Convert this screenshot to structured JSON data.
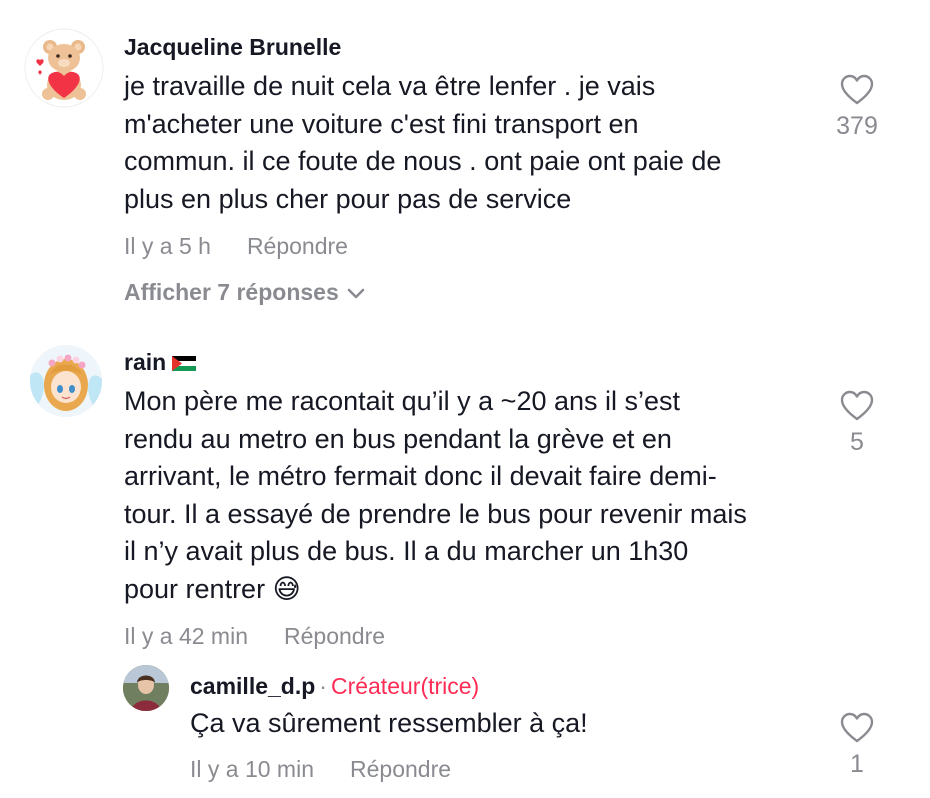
{
  "comments": [
    {
      "username": "Jacqueline Brunelle",
      "text": "je travaille de nuit cela va être lenfer . je vais\nm'acheter une voiture c'est fini transport en\ncommun. il ce foute de nous . ont paie ont paie de\nplus en plus cher pour pas de service",
      "time": "Il y a 5 h",
      "reply_label": "Répondre",
      "likes": "379",
      "view_replies": "Afficher 7 réponses",
      "avatar_icon": "teddy-bear-heart-icon"
    },
    {
      "username": "rain",
      "flag_icon": "palestine-flag-icon",
      "text": "Mon père me racontait qu’il y a ~20 ans il s’est\nrendu au metro en bus pendant la grève et en\narrivant, le métro fermait donc il devait faire demi-\ntour. Il a essayé de prendre le bus pour revenir mais\nil n’y avait plus de bus. Il a du marcher un 1h30\npour rentrer 😅",
      "time": "Il y a 42 min",
      "reply_label": "Répondre",
      "likes": "5",
      "avatar_icon": "anime-girl-avatar-icon"
    }
  ],
  "reply": {
    "username": "camille_d.p",
    "separator": "·",
    "creator_tag": "Créateur(trice)",
    "text": "Ça va sûrement ressembler à ça!",
    "time": "Il y a 10 min",
    "reply_label": "Répondre",
    "likes": "1",
    "avatar_icon": "user-photo-avatar-icon"
  },
  "colors": {
    "text": "#161823",
    "muted": "#8a8b91",
    "creator": "#fe2c55"
  }
}
